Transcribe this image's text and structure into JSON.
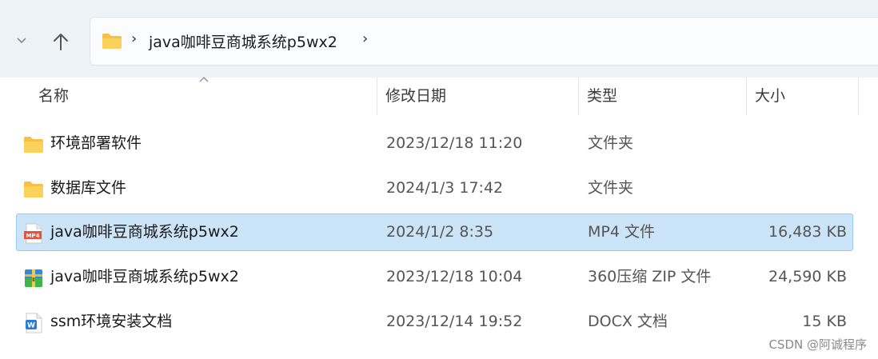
{
  "address_bar": {
    "path": "java咖啡豆商城系统p5wx2",
    "separator": "›"
  },
  "columns": {
    "name": "名称",
    "modified": "修改日期",
    "type": "类型",
    "size": "大小"
  },
  "files": [
    {
      "name": "环境部署软件",
      "modified": "2023/12/18 11:20",
      "type": "文件夹",
      "size": "",
      "icon": "folder-icon",
      "selected": false
    },
    {
      "name": "数据库文件",
      "modified": "2024/1/3 17:42",
      "type": "文件夹",
      "size": "",
      "icon": "folder-icon",
      "selected": false
    },
    {
      "name": "java咖啡豆商城系统p5wx2",
      "modified": "2024/1/2 8:35",
      "type": "MP4 文件",
      "size": "16,483 KB",
      "icon": "mp4-file-icon",
      "selected": true
    },
    {
      "name": "java咖啡豆商城系统p5wx2",
      "modified": "2023/12/18 10:04",
      "type": "360压缩 ZIP 文件",
      "size": "24,590 KB",
      "icon": "zip-archive-icon",
      "selected": false
    },
    {
      "name": "ssm环境安装文档",
      "modified": "2023/12/14 19:52",
      "type": "DOCX 文档",
      "size": "15 KB",
      "icon": "docx-file-icon",
      "selected": false
    }
  ],
  "mp4_icon_label": "MP4",
  "docx_icon_label": "W",
  "watermark": "CSDN @阿诚程序",
  "colors": {
    "selection_bg": "#cce4f7",
    "selection_border": "#99c9ef",
    "folder": "#f5c043",
    "toolbar_bg": "#eef3f8"
  }
}
